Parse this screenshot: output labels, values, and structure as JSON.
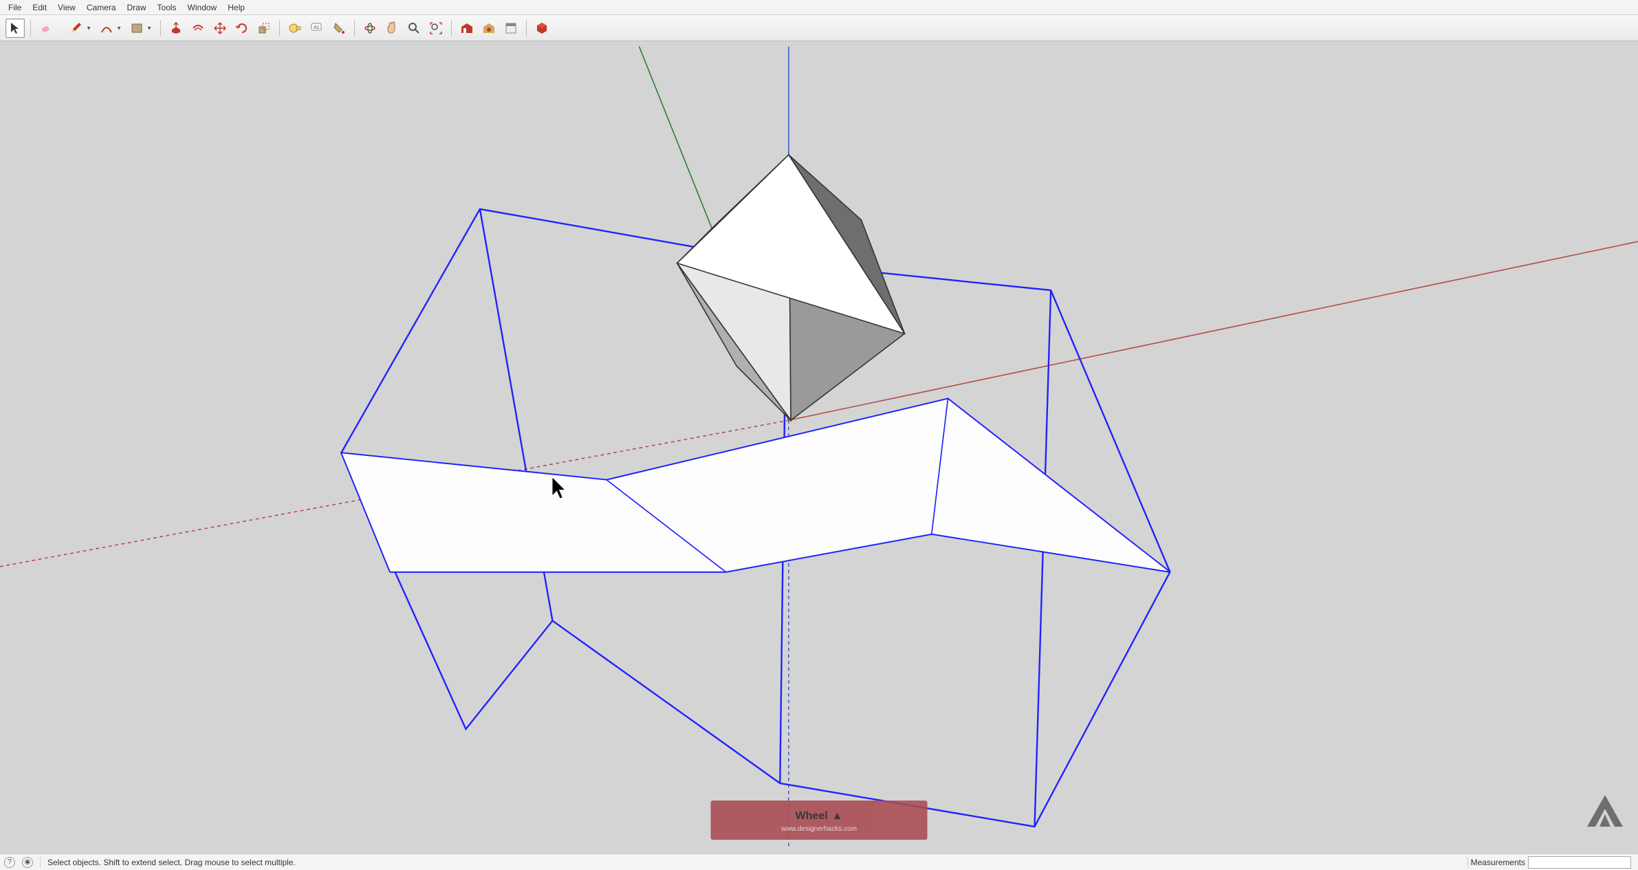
{
  "menubar": {
    "items": [
      "File",
      "Edit",
      "View",
      "Camera",
      "Draw",
      "Tools",
      "Window",
      "Help"
    ]
  },
  "toolbar": {
    "select": "Select",
    "eraser": "Eraser",
    "pencil": "Line",
    "arc": "Arc",
    "shape": "Shape",
    "pushpull": "Push/Pull",
    "offset": "Offset",
    "move": "Move",
    "rotate": "Rotate",
    "scale": "Scale",
    "tape": "Tape Measure",
    "text": "Text",
    "paint": "Paint Bucket",
    "orbit": "Orbit",
    "pan": "Pan",
    "zoom": "Zoom",
    "zoomext": "Zoom Extents",
    "warehouse": "3D Warehouse",
    "extwarehouse": "Extension Warehouse",
    "layout": "LayOut",
    "extmanager": "Extension Manager"
  },
  "overlay": {
    "title": "Wheel",
    "subtitle": "www.designerhacks.com"
  },
  "statusbar": {
    "hint": "Select objects. Shift to extend select. Drag mouse to select multiple.",
    "measure_label": "Measurements"
  }
}
